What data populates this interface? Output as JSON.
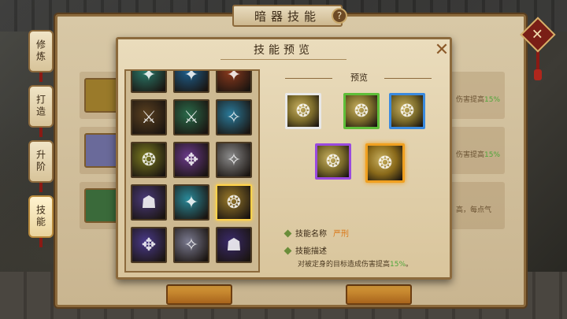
{
  "window": {
    "title": "暗器技能",
    "help_glyph": "?",
    "close_glyph": "✕"
  },
  "side_tabs": [
    {
      "label": "修炼",
      "active": false
    },
    {
      "label": "打造",
      "active": false
    },
    {
      "label": "升阶",
      "active": false
    },
    {
      "label": "技能",
      "active": true
    }
  ],
  "background_rows": [
    {
      "text_before": "伤害提高",
      "highlight": "15%"
    },
    {
      "text_before": "伤害提高",
      "highlight": "15%"
    },
    {
      "text_before": "高，每点气"
    }
  ],
  "dialog": {
    "title": "技能预览",
    "close_glyph": "✕",
    "preview_label": "预览",
    "skill_name_label": "技能名称",
    "skill_name_value": "严刑",
    "skill_desc_label": "技能描述",
    "skill_desc_text": "对被定身的目标造成伤害提高",
    "skill_desc_highlight": "15%",
    "skill_desc_end": "。"
  },
  "grid_icons": [
    {
      "name": "skill-icon-1",
      "color": "#2a7a6a",
      "glyph": "✦"
    },
    {
      "name": "skill-icon-2",
      "color": "#1d5e8c",
      "glyph": "✦"
    },
    {
      "name": "skill-icon-3",
      "color": "#8c3a1d",
      "glyph": "✦"
    },
    {
      "name": "skill-icon-4",
      "color": "#5a4020",
      "glyph": "⚔"
    },
    {
      "name": "skill-icon-5",
      "color": "#2a6a4a",
      "glyph": "⚔"
    },
    {
      "name": "skill-icon-6",
      "color": "#2a7a9a",
      "glyph": "✧"
    },
    {
      "name": "skill-icon-7",
      "color": "#7a7a20",
      "glyph": "❂"
    },
    {
      "name": "skill-icon-8",
      "color": "#6a3a8a",
      "glyph": "✥"
    },
    {
      "name": "skill-icon-9",
      "color": "#8a8a8a",
      "glyph": "✧"
    },
    {
      "name": "skill-icon-10",
      "color": "#4a3a7a",
      "glyph": "☗"
    },
    {
      "name": "skill-icon-11",
      "color": "#2a8a9a",
      "glyph": "✦"
    },
    {
      "name": "skill-icon-12",
      "color": "#9a7a2a",
      "glyph": "❂",
      "selected": true
    },
    {
      "name": "skill-icon-13",
      "color": "#4a3a8a",
      "glyph": "✥"
    },
    {
      "name": "skill-icon-14",
      "color": "#7a7a90",
      "glyph": "✧"
    },
    {
      "name": "skill-icon-15",
      "color": "#3a2a6a",
      "glyph": "☗"
    }
  ],
  "preview_icons": [
    {
      "name": "preview-icon-white",
      "border": "#e8e8e8",
      "color": "#7a6a2a"
    },
    {
      "name": "preview-icon-green",
      "border": "#5fbf3a",
      "color": "#7a6a2a"
    },
    {
      "name": "preview-icon-blue",
      "border": "#3a8adf",
      "color": "#7a6a2a"
    },
    {
      "name": "preview-icon-purple",
      "border": "#9a4adf",
      "color": "#7a6a2a"
    },
    {
      "name": "preview-icon-orange",
      "border": "#f0a020",
      "color": "#8a6a1a",
      "selected": true
    }
  ],
  "colors": {
    "accent_orange": "#d9791a",
    "highlight_green": "#4fa63a",
    "frame_brown": "#8c6a3c"
  }
}
